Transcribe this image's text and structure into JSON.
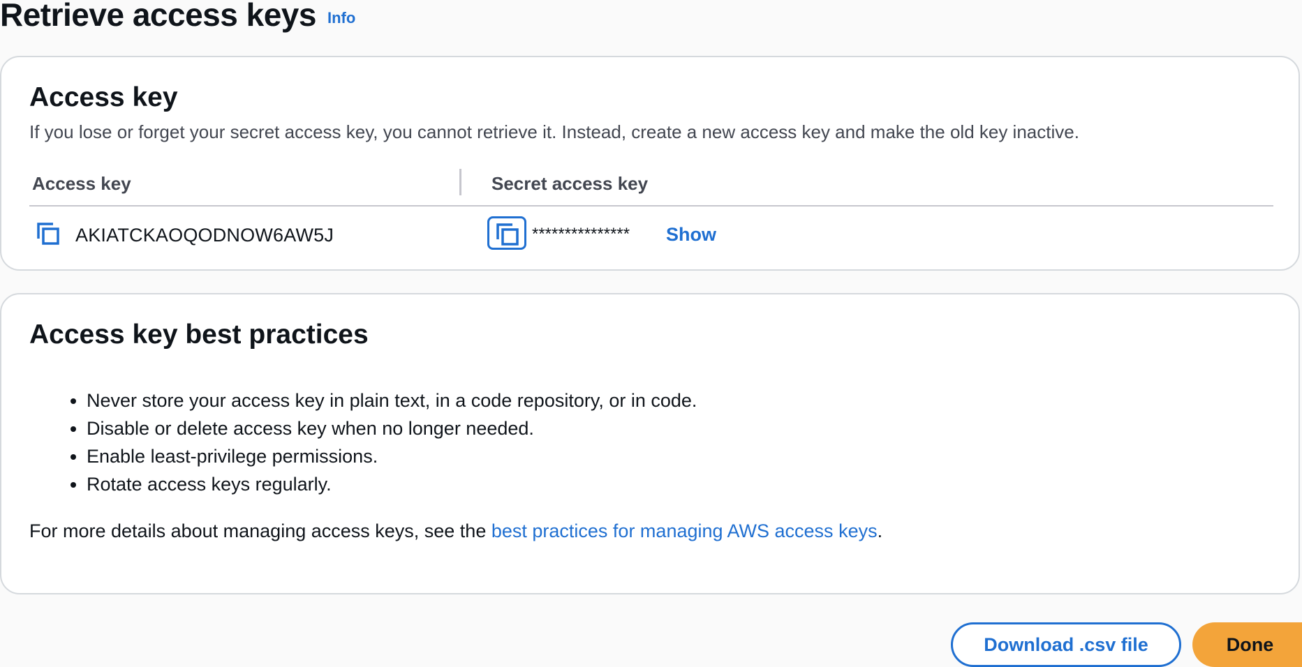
{
  "header": {
    "title": "Retrieve access keys",
    "info_label": "Info"
  },
  "access_key_card": {
    "title": "Access key",
    "description": "If you lose or forget your secret access key, you cannot retrieve it. Instead, create a new access key and make the old key inactive.",
    "table": {
      "columns": [
        "Access key",
        "Secret access key"
      ],
      "row": {
        "access_key": "AKIATCKAOQODNOW6AW5J",
        "secret_masked": "***************",
        "show_label": "Show"
      }
    }
  },
  "best_practices_card": {
    "title": "Access key best practices",
    "items": [
      "Never store your access key in plain text, in a code repository, or in code.",
      "Disable or delete access key when no longer needed.",
      "Enable least-privilege permissions.",
      "Rotate access keys regularly."
    ],
    "details_prefix": "For more details about managing access keys, see the ",
    "details_link": "best practices for managing AWS access keys",
    "details_suffix": "."
  },
  "actions": {
    "download_label": "Download .csv file",
    "done_label": "Done"
  },
  "colors": {
    "link": "#1f6fd1",
    "primary_button": "#f3a43a",
    "border": "#d5d9dd"
  },
  "icons": {
    "copy": "copy-icon"
  }
}
